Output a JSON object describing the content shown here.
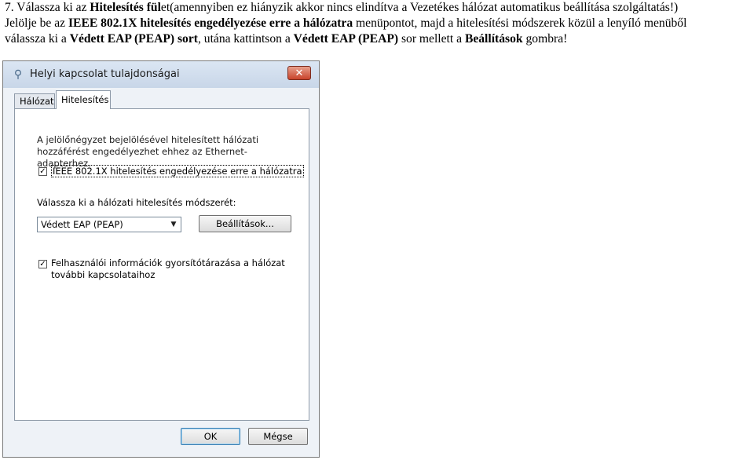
{
  "instructions": {
    "line1_prefix": "7. Válassza ki az ",
    "line1_bold1": "Hitelesítés fül",
    "line1_rest": "et(amennyiben ez hiányzik akkor nincs elindítva a Vezetékes hálózat automatikus beállítása szolgáltatás!)",
    "line2_prefix": "Jelölje be az ",
    "line2_bold1": "IEEE 802.1X hitelesítés engedélyezése erre a hálózatra",
    "line2_rest": " menüpontot, majd a hitelesítési módszerek közül a lenyíló menüből",
    "line3_prefix": "válassza ki a ",
    "line3_bold1": "Védett EAP (PEAP) sort",
    "line3_mid": ", utána kattintson a ",
    "line3_bold2": "Védett EAP (PEAP)",
    "line3_mid2": " sor mellett a ",
    "line3_bold3": "Beállítások",
    "line3_end": " gombra!"
  },
  "dialog": {
    "title": "Helyi kapcsolat tulajdonságai",
    "close_glyph": "✕",
    "tabs": [
      "Hálózat",
      "Hitelesítés"
    ],
    "description": "A jelölőnégyzet bejelölésével hitelesített hálózati hozzáférést engedélyezhet ehhez az Ethernet-adapterhez.",
    "enable_8021x_label": "IEEE 802.1X hitelesítés engedélyezése erre a hálózatra",
    "enable_8021x_checked": true,
    "choose_method_label": "Válassza ki a hálózati hitelesítés módszerét:",
    "method_selected": "Védett EAP (PEAP)",
    "settings_button": "Beállítások...",
    "cache_label": "Felhasználói információk gyorsítótárazása a hálózat további kapcsolataihoz",
    "cache_checked": true,
    "ok_button": "OK",
    "cancel_button": "Mégse",
    "check_glyph": "✓",
    "arrow_glyph": "▼",
    "title_icon_glyph": "⚲"
  }
}
